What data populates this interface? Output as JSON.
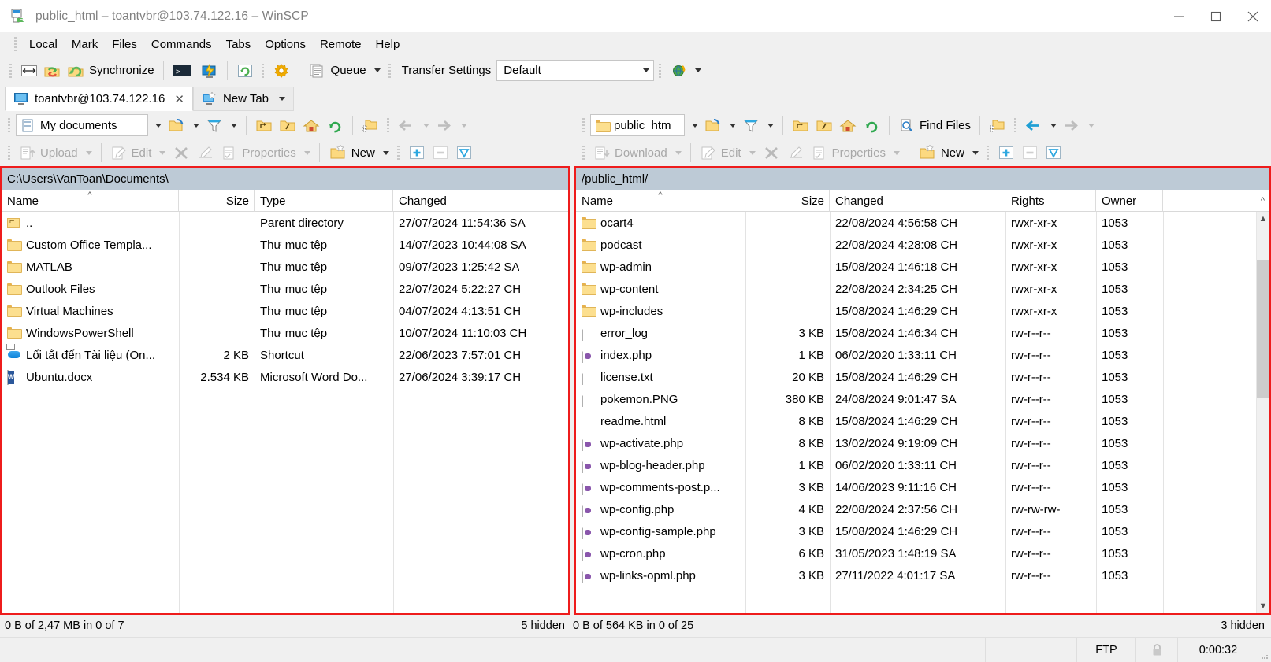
{
  "window": {
    "title": "public_html – toantvbr@103.74.122.16 – WinSCP",
    "minimize": "–",
    "maximize": "□",
    "close": "✕"
  },
  "menu": [
    "Local",
    "Mark",
    "Files",
    "Commands",
    "Tabs",
    "Options",
    "Remote",
    "Help"
  ],
  "toolbar": {
    "synchronize_label": "Synchronize",
    "queue_label": "Queue",
    "transfer_settings_label": "Transfer Settings",
    "transfer_settings_value": "Default"
  },
  "tabs": {
    "active": "toantvbr@103.74.122.16",
    "close_glyph": "✕",
    "new_tab": "New Tab"
  },
  "left_panel": {
    "location_label": "My documents",
    "find_label": "",
    "action_bar": {
      "transfer": "Upload",
      "edit": "Edit",
      "delete": "✕",
      "properties": "Properties",
      "new": "New"
    },
    "path": "C:\\Users\\VanToan\\Documents\\",
    "columns": [
      "Name",
      "Size",
      "Type",
      "Changed"
    ],
    "sort_column": "Name",
    "files": [
      {
        "name": "..",
        "size": "",
        "type": "Parent directory",
        "changed": "27/07/2024 11:54:36 SA",
        "icon": "parent-folder-icon"
      },
      {
        "name": "Custom Office Templa...",
        "size": "",
        "type": "Thư mục tệp",
        "changed": "14/07/2023 10:44:08 SA",
        "icon": "folder-icon"
      },
      {
        "name": "MATLAB",
        "size": "",
        "type": "Thư mục tệp",
        "changed": "09/07/2023 1:25:42 SA",
        "icon": "folder-icon"
      },
      {
        "name": "Outlook Files",
        "size": "",
        "type": "Thư mục tệp",
        "changed": "22/07/2024 5:22:27 CH",
        "icon": "folder-icon"
      },
      {
        "name": "Virtual Machines",
        "size": "",
        "type": "Thư mục tệp",
        "changed": "04/07/2024 4:13:51 CH",
        "icon": "folder-icon"
      },
      {
        "name": "WindowsPowerShell",
        "size": "",
        "type": "Thư mục tệp",
        "changed": "10/07/2024 11:10:03 CH",
        "icon": "folder-icon"
      },
      {
        "name": "Lối tắt đến Tài liệu (On...",
        "size": "2 KB",
        "type": "Shortcut",
        "changed": "22/06/2023 7:57:01 CH",
        "icon": "onedrive-shortcut-icon"
      },
      {
        "name": "Ubuntu.docx",
        "size": "2.534 KB",
        "type": "Microsoft Word Do...",
        "changed": "27/06/2024 3:39:17 CH",
        "icon": "word-doc-icon"
      }
    ],
    "status": "0 B of 2,47 MB in 0 of 7",
    "hidden": "5 hidden"
  },
  "right_panel": {
    "location_label": "public_htm",
    "find_files_label": "Find Files",
    "action_bar": {
      "transfer": "Download",
      "edit": "Edit",
      "delete": "✕",
      "properties": "Properties",
      "new": "New"
    },
    "path": "/public_html/",
    "columns": [
      "Name",
      "Size",
      "Changed",
      "Rights",
      "Owner"
    ],
    "sort_column": "Name",
    "files": [
      {
        "name": "ocart4",
        "size": "",
        "changed": "22/08/2024 4:56:58 CH",
        "rights": "rwxr-xr-x",
        "owner": "1053",
        "icon": "folder-icon"
      },
      {
        "name": "podcast",
        "size": "",
        "changed": "22/08/2024 4:28:08 CH",
        "rights": "rwxr-xr-x",
        "owner": "1053",
        "icon": "folder-icon"
      },
      {
        "name": "wp-admin",
        "size": "",
        "changed": "15/08/2024 1:46:18 CH",
        "rights": "rwxr-xr-x",
        "owner": "1053",
        "icon": "folder-icon"
      },
      {
        "name": "wp-content",
        "size": "",
        "changed": "22/08/2024 2:34:25 CH",
        "rights": "rwxr-xr-x",
        "owner": "1053",
        "icon": "folder-icon"
      },
      {
        "name": "wp-includes",
        "size": "",
        "changed": "15/08/2024 1:46:29 CH",
        "rights": "rwxr-xr-x",
        "owner": "1053",
        "icon": "folder-icon"
      },
      {
        "name": "error_log",
        "size": "3 KB",
        "changed": "15/08/2024 1:46:34 CH",
        "rights": "rw-r--r--",
        "owner": "1053",
        "icon": "blank-doc-icon"
      },
      {
        "name": "index.php",
        "size": "1 KB",
        "changed": "06/02/2020 1:33:11 CH",
        "rights": "rw-r--r--",
        "owner": "1053",
        "icon": "php-file-icon"
      },
      {
        "name": "license.txt",
        "size": "20 KB",
        "changed": "15/08/2024 1:46:29 CH",
        "rights": "rw-r--r--",
        "owner": "1053",
        "icon": "text-file-icon"
      },
      {
        "name": "pokemon.PNG",
        "size": "380 KB",
        "changed": "24/08/2024 9:01:47 SA",
        "rights": "rw-r--r--",
        "owner": "1053",
        "icon": "image-file-icon"
      },
      {
        "name": "readme.html",
        "size": "8 KB",
        "changed": "15/08/2024 1:46:29 CH",
        "rights": "rw-r--r--",
        "owner": "1053",
        "icon": "edge-html-icon"
      },
      {
        "name": "wp-activate.php",
        "size": "8 KB",
        "changed": "13/02/2024 9:19:09 CH",
        "rights": "rw-r--r--",
        "owner": "1053",
        "icon": "php-file-icon"
      },
      {
        "name": "wp-blog-header.php",
        "size": "1 KB",
        "changed": "06/02/2020 1:33:11 CH",
        "rights": "rw-r--r--",
        "owner": "1053",
        "icon": "php-file-icon"
      },
      {
        "name": "wp-comments-post.p...",
        "size": "3 KB",
        "changed": "14/06/2023 9:11:16 CH",
        "rights": "rw-r--r--",
        "owner": "1053",
        "icon": "php-file-icon"
      },
      {
        "name": "wp-config.php",
        "size": "4 KB",
        "changed": "22/08/2024 2:37:56 CH",
        "rights": "rw-rw-rw-",
        "owner": "1053",
        "icon": "php-file-icon"
      },
      {
        "name": "wp-config-sample.php",
        "size": "3 KB",
        "changed": "15/08/2024 1:46:29 CH",
        "rights": "rw-r--r--",
        "owner": "1053",
        "icon": "php-file-icon"
      },
      {
        "name": "wp-cron.php",
        "size": "6 KB",
        "changed": "31/05/2023 1:48:19 SA",
        "rights": "rw-r--r--",
        "owner": "1053",
        "icon": "php-file-icon"
      },
      {
        "name": "wp-links-opml.php",
        "size": "3 KB",
        "changed": "27/11/2022 4:01:17 SA",
        "rights": "rw-r--r--",
        "owner": "1053",
        "icon": "php-file-icon"
      }
    ],
    "status": "0 B of 564 KB in 0 of 25",
    "hidden": "3 hidden"
  },
  "statusbar": {
    "protocol": "FTP",
    "secure_icon": "lock-icon",
    "duration": "0:00:32"
  },
  "colors": {
    "selection_frame": "#ee1c1c",
    "address_bg": "#bdcad6",
    "chrome_bg": "#f0f0f0"
  }
}
